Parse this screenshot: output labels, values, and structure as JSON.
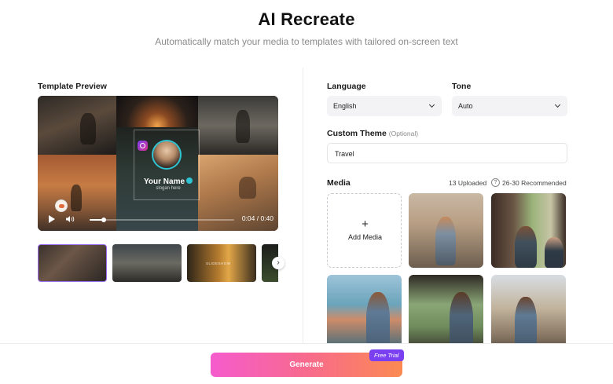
{
  "header": {
    "title": "AI Recreate",
    "subtitle": "Automatically match your media to templates with tailored on-screen text"
  },
  "template": {
    "section_label": "Template Preview",
    "overlay_name": "Your Name",
    "overlay_slogan": "slogan here",
    "time_display": "0:04 / 0:40",
    "progress": 0.1,
    "thumbnail_caption": "SLIDESHOW"
  },
  "settings": {
    "language_label": "Language",
    "language_value": "English",
    "tone_label": "Tone",
    "tone_value": "Auto",
    "theme_label": "Custom Theme",
    "theme_optional": "(Optional)",
    "theme_value": "Travel"
  },
  "media": {
    "label": "Media",
    "uploaded": "13 Uploaded",
    "recommended": "26-30 Recommended",
    "add_label": "Add Media",
    "add_glyph": "+"
  },
  "footer": {
    "generate_label": "Generate",
    "badge": "Free Trial"
  },
  "colors": {
    "accent_purple": "#7b3ff2",
    "gradient_start": "#f55ccd",
    "gradient_end": "#fb8a52"
  }
}
